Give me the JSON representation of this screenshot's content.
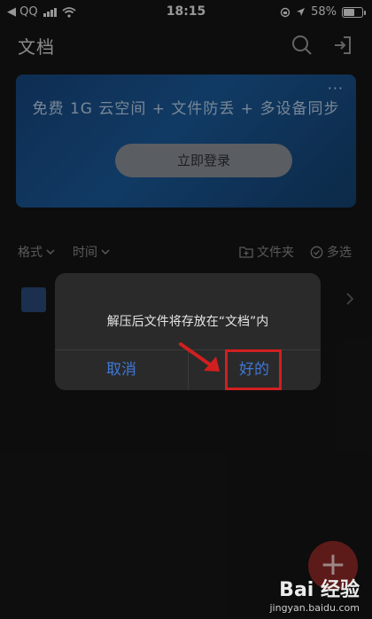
{
  "statusbar": {
    "carrier": "◀ QQ",
    "time": "18:15",
    "battery": "58%",
    "battery_level": 0.58
  },
  "topbar": {
    "title": "文档",
    "icons": [
      "search-icon",
      "export-icon"
    ]
  },
  "banner": {
    "title": "免费 1G 云空间 + 文件防丢 + 多设备同步",
    "button": "立即登录",
    "more": "···"
  },
  "filters": {
    "format": "格式",
    "time": "时间",
    "folder": "文件夹",
    "multi_select": "多选"
  },
  "dialog": {
    "message": "解压后文件将存放在“文档”内",
    "cancel": "取消",
    "ok": "好的"
  },
  "fab": {
    "label": "+"
  },
  "watermark": {
    "main": "Bai 经验",
    "sub": "jingyan.baidu.com"
  },
  "colors": {
    "background": "#151515",
    "banner": "#1a5a9a",
    "dialog_button": "#3f78d6",
    "highlight": "#d11f1f",
    "fab": "#8e2a27"
  }
}
